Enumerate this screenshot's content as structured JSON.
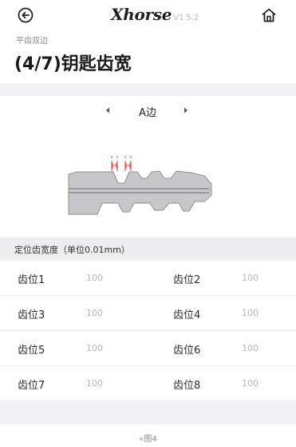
{
  "header": {
    "logo_text": "Xhorse",
    "version": "V1.5.2",
    "breadcrumb": "平齿双边",
    "title": "(4/7)钥匙齿宽"
  },
  "side_selector": {
    "label": "A边"
  },
  "key_diagram": {
    "marker_label": "H"
  },
  "section": {
    "title": "定位齿宽度（单位0.01mm）"
  },
  "positions": [
    {
      "label": "齿位1",
      "value": "100"
    },
    {
      "label": "齿位2",
      "value": "100"
    },
    {
      "label": "齿位3",
      "value": "100"
    },
    {
      "label": "齿位4",
      "value": "100"
    },
    {
      "label": "齿位5",
      "value": "100"
    },
    {
      "label": "齿位6",
      "value": "100"
    },
    {
      "label": "齿位7",
      "value": "100"
    },
    {
      "label": "齿位8",
      "value": "100"
    }
  ],
  "footer": {
    "label": "«图4"
  },
  "colors": {
    "marker": "#e0453a",
    "key_fill": "#c6c6cb",
    "key_stroke": "#8e8e94"
  }
}
